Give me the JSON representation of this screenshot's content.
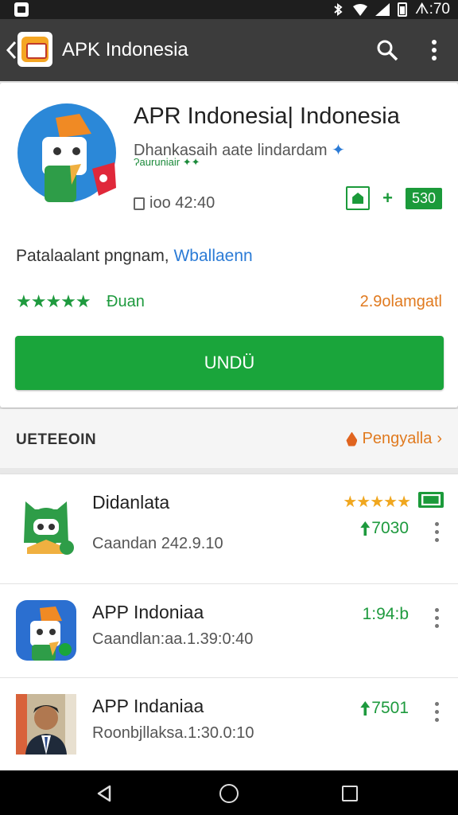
{
  "status_bar": {
    "time": "ᗑ:70"
  },
  "app_bar": {
    "title": "APK Indonesia"
  },
  "app": {
    "title": "APR Indonesia| Indonesia",
    "developer": "Dhankasaih aate lindardam",
    "developer_sub": "Ɂauruniair",
    "meta_date": "ioo 42:40",
    "age_rating": "530",
    "description": "Patalaalant pngnam,",
    "description_link": "Wballaenn",
    "stars": "★★★★★",
    "rating_label": "Ɖuan",
    "downloads": "2.9olamgatl",
    "install_label": "UNDÜ"
  },
  "section": {
    "title": "UETEEOIN",
    "more_label": "Pengyalla"
  },
  "list_items": [
    {
      "name": "Didanlata",
      "sub": "Caandan 242.9.10",
      "size": "7030",
      "stars": "★★★★★"
    },
    {
      "name": "APP Indoniaa",
      "sub": "Caandlan:aa.1.39:0:40",
      "size": "1:94:b"
    },
    {
      "name": "APP Indaniaa",
      "sub": "Roonbjllaksa.1:30.0:10",
      "size": "7501"
    }
  ],
  "colors": {
    "accent_green": "#1aa53b",
    "app_bar": "#3c3c3c",
    "orange": "#e07a1f",
    "link_blue": "#2b7bd6"
  },
  "icons": [
    "notification-icon",
    "bluetooth-icon",
    "wifi-icon",
    "signal-icon",
    "battery-icon",
    "back-arrow-icon",
    "search-icon",
    "more-vert-icon",
    "calendar-icon",
    "editors-choice-icon",
    "fire-icon",
    "download-arrow-icon",
    "nav-back-icon",
    "nav-home-icon",
    "nav-recents-icon"
  ]
}
